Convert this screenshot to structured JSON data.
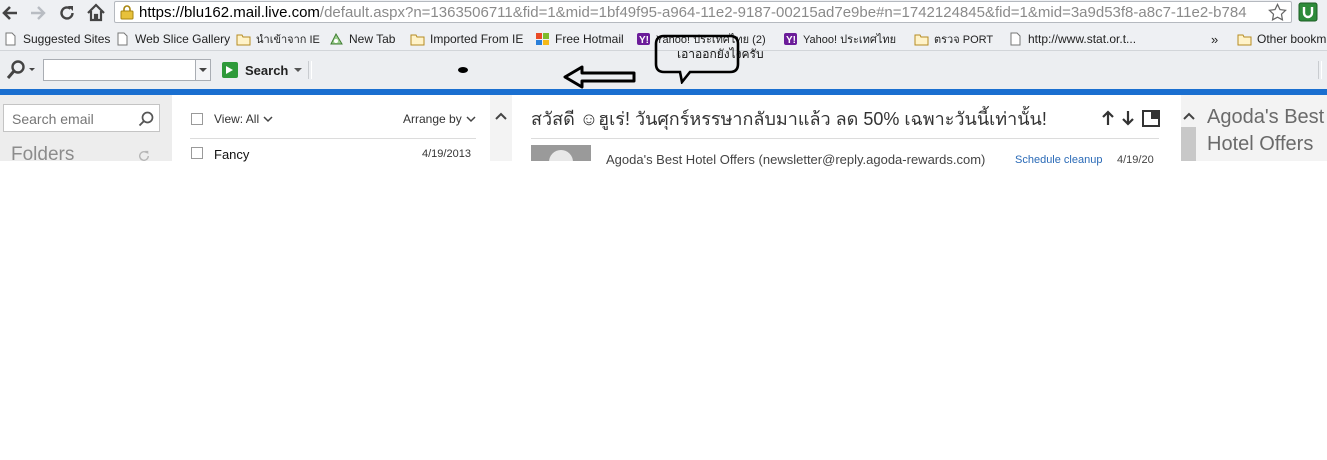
{
  "browser": {
    "url_host": "https://blu162.mail.live.com",
    "url_path": "/default.aspx?n=1363506711&fid=1&mid=1bf49f95-a964-11e2-9187-00215ad7e9be#n=1742124845&fid=1&mid=3a9d53f8-a8c7-11e2-b784"
  },
  "bookmarks": {
    "items": [
      {
        "label": "Suggested Sites",
        "icon": "page-icon"
      },
      {
        "label": "Web Slice Gallery",
        "icon": "page-icon"
      },
      {
        "label": "นำเข้าจาก IE",
        "icon": "folder-icon"
      },
      {
        "label": "New Tab",
        "icon": "new-tab-icon"
      },
      {
        "label": "Imported From IE",
        "icon": "folder-icon"
      },
      {
        "label": "Free Hotmail",
        "icon": "windows-flag-icon"
      },
      {
        "label": "Yahoo! ประเทศไทย (2)",
        "icon": "yahoo-icon"
      },
      {
        "label": "Yahoo! ประเทศไทย",
        "icon": "yahoo-icon"
      },
      {
        "label": "ตรวจ PORT",
        "icon": "folder-icon"
      },
      {
        "label": "http://www.stat.or.t...",
        "icon": "page-icon"
      }
    ],
    "overflow": "»",
    "other": "Other bookm"
  },
  "toolbar": {
    "search_label": "Search",
    "search_value": ""
  },
  "annotation": {
    "bubble_text": "เอาออกยังไงครับ"
  },
  "mail": {
    "search_placeholder": "Search email",
    "folders_label": "Folders",
    "view_label": "View: All",
    "arrange_label": "Arrange by",
    "message_sender": "Fancy",
    "message_date": "4/19/2013",
    "reading_subject": "สวัสดี ☺ฮูเร่! วันศุกร์หรรษากลับมาแล้ว ลด 50% เฉพาะวันนี้เท่านั้น!",
    "reading_from": "Agoda's Best Hotel Offers (newsletter@reply.agoda-rewards.com)",
    "schedule_cleanup": "Schedule cleanup",
    "reading_date": "4/19/20",
    "ad_title": "Agoda's Best Hotel Offers"
  },
  "colors": {
    "accent_band": "#1a6fd0",
    "link_blue": "#2a6ab7",
    "toolbar_green": "#2e9a3a"
  }
}
